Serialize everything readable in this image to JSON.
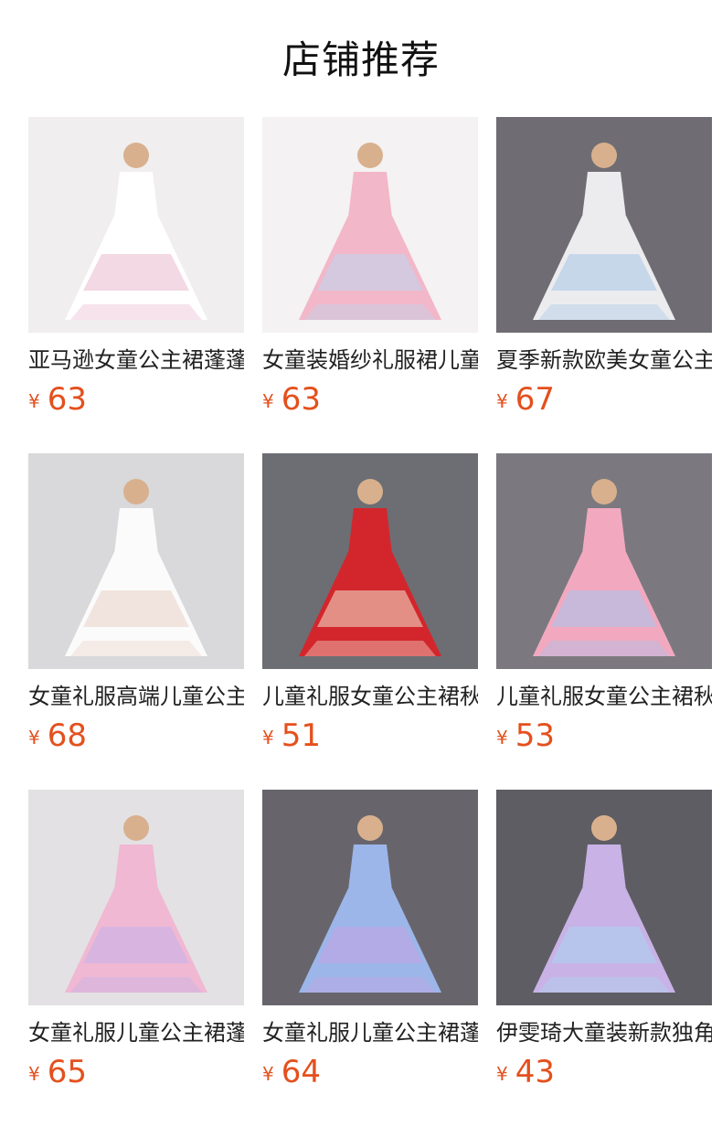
{
  "header": {
    "title": "店铺推荐"
  },
  "products": [
    {
      "name": "亚马逊女童公主裙蓬蓬",
      "currency": "¥",
      "price": "63",
      "bg": "#f0eeee",
      "dress": "#ffffff",
      "accent": "#e9b9cd",
      "icon": "white-gown-photo"
    },
    {
      "name": "女童装婚纱礼服裙儿童",
      "currency": "¥",
      "price": "63",
      "bg": "#f4f2f2",
      "dress": "#f2b7c8",
      "accent": "#bcd8f0",
      "icon": "rainbow-gown-photo"
    },
    {
      "name": "夏季新款欧美女童公主",
      "currency": "¥",
      "price": "67",
      "bg": "#6f6d73",
      "dress": "#ececef",
      "accent": "#a9c7e6",
      "icon": "white-mannequin-gown-photo"
    },
    {
      "name": "女童礼服高端儿童公主",
      "currency": "¥",
      "price": "68",
      "bg": "#d9d8da",
      "dress": "#fbfbfb",
      "accent": "#ead2c7",
      "icon": "tiered-white-gown-photo"
    },
    {
      "name": "儿童礼服女童公主裙秋",
      "currency": "¥",
      "price": "51",
      "bg": "#6c6e73",
      "dress": "#d3262c",
      "accent": "#f3e6d2",
      "icon": "red-dress-photo"
    },
    {
      "name": "儿童礼服女童公主裙秋",
      "currency": "¥",
      "price": "53",
      "bg": "#7b797f",
      "dress": "#f2a9c0",
      "accent": "#a5c4ee",
      "icon": "unicorn-rainbow-gown-photo"
    },
    {
      "name": "女童礼服儿童公主裙蓬",
      "currency": "¥",
      "price": "65",
      "bg": "#e3e1e4",
      "dress": "#f0b8d2",
      "accent": "#c4b3ec",
      "icon": "pink-butterfly-gown-photo"
    },
    {
      "name": "女童礼服儿童公主裙蓬",
      "currency": "¥",
      "price": "64",
      "bg": "#67656b",
      "dress": "#9cb6ea",
      "accent": "#c7a3e2",
      "icon": "blue-purple-gown-photo"
    },
    {
      "name": "伊雯琦大童装新款独角",
      "currency": "¥",
      "price": "43",
      "bg": "#5e5d63",
      "dress": "#c8b2e6",
      "accent": "#a9d6f0",
      "icon": "three-unicorn-dresses-photo"
    }
  ]
}
